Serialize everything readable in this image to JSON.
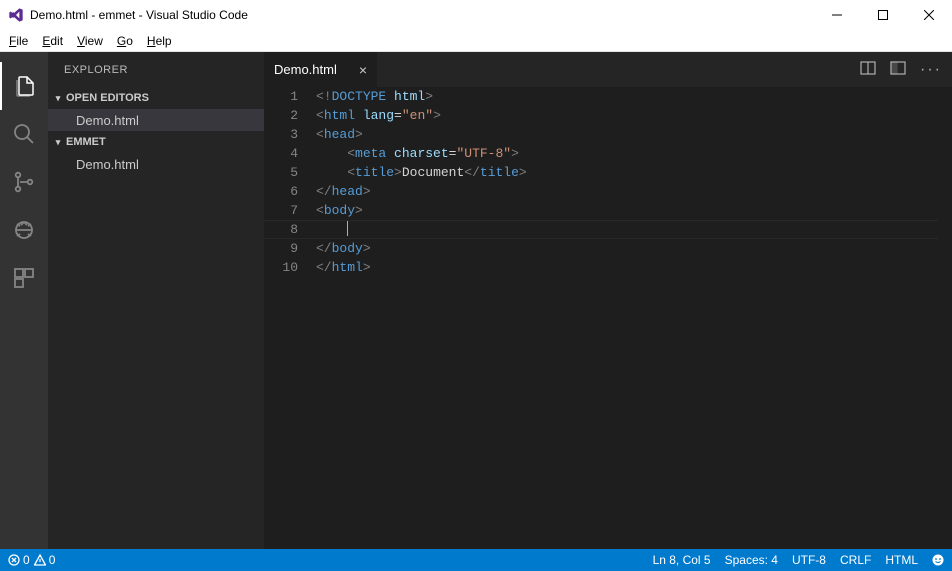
{
  "window": {
    "title": "Demo.html - emmet - Visual Studio Code"
  },
  "menubar": {
    "file": "File",
    "edit": "Edit",
    "view": "View",
    "go": "Go",
    "help": "Help"
  },
  "sidebar": {
    "title": "EXPLORER",
    "sections": {
      "open_editors": {
        "label": "OPEN EDITORS",
        "items": [
          "Demo.html"
        ]
      },
      "folder": {
        "label": "EMMET",
        "items": [
          "Demo.html"
        ]
      }
    }
  },
  "tabs": {
    "active": "Demo.html"
  },
  "editor": {
    "line_numbers": [
      "1",
      "2",
      "3",
      "4",
      "5",
      "6",
      "7",
      "8",
      "9",
      "10"
    ],
    "code_tokens": [
      [
        [
          "sy-gray",
          "<!"
        ],
        [
          "sy-doc",
          "DOCTYPE "
        ],
        [
          "sy-attr",
          "html"
        ],
        [
          "sy-gray",
          ">"
        ]
      ],
      [
        [
          "sy-gray",
          "<"
        ],
        [
          "sy-tag",
          "html "
        ],
        [
          "sy-attr",
          "lang"
        ],
        [
          "sy-wht",
          "="
        ],
        [
          "sy-str",
          "\"en\""
        ],
        [
          "sy-gray",
          ">"
        ]
      ],
      [
        [
          "sy-gray",
          "<"
        ],
        [
          "sy-tag",
          "head"
        ],
        [
          "sy-gray",
          ">"
        ]
      ],
      [
        [
          "sy-wht",
          "    "
        ],
        [
          "sy-gray",
          "<"
        ],
        [
          "sy-tag",
          "meta "
        ],
        [
          "sy-attr",
          "charset"
        ],
        [
          "sy-wht",
          "="
        ],
        [
          "sy-str",
          "\"UTF-8\""
        ],
        [
          "sy-gray",
          ">"
        ]
      ],
      [
        [
          "sy-wht",
          "    "
        ],
        [
          "sy-gray",
          "<"
        ],
        [
          "sy-tag",
          "title"
        ],
        [
          "sy-gray",
          ">"
        ],
        [
          "sy-wht",
          "Document"
        ],
        [
          "sy-gray",
          "</"
        ],
        [
          "sy-tag",
          "title"
        ],
        [
          "sy-gray",
          ">"
        ]
      ],
      [
        [
          "sy-gray",
          "</"
        ],
        [
          "sy-tag",
          "head"
        ],
        [
          "sy-gray",
          ">"
        ]
      ],
      [
        [
          "sy-gray",
          "<"
        ],
        [
          "sy-tag",
          "body"
        ],
        [
          "sy-gray",
          ">"
        ]
      ],
      [
        [
          "sy-wht",
          "    "
        ]
      ],
      [
        [
          "sy-gray",
          "</"
        ],
        [
          "sy-tag",
          "body"
        ],
        [
          "sy-gray",
          ">"
        ]
      ],
      [
        [
          "sy-gray",
          "</"
        ],
        [
          "sy-tag",
          "html"
        ],
        [
          "sy-gray",
          ">"
        ]
      ]
    ],
    "cursor_line_index": 7
  },
  "statusbar": {
    "errors": "0",
    "warnings": "0",
    "position": "Ln 8, Col 5",
    "spaces": "Spaces: 4",
    "encoding": "UTF-8",
    "eol": "CRLF",
    "language": "HTML"
  }
}
